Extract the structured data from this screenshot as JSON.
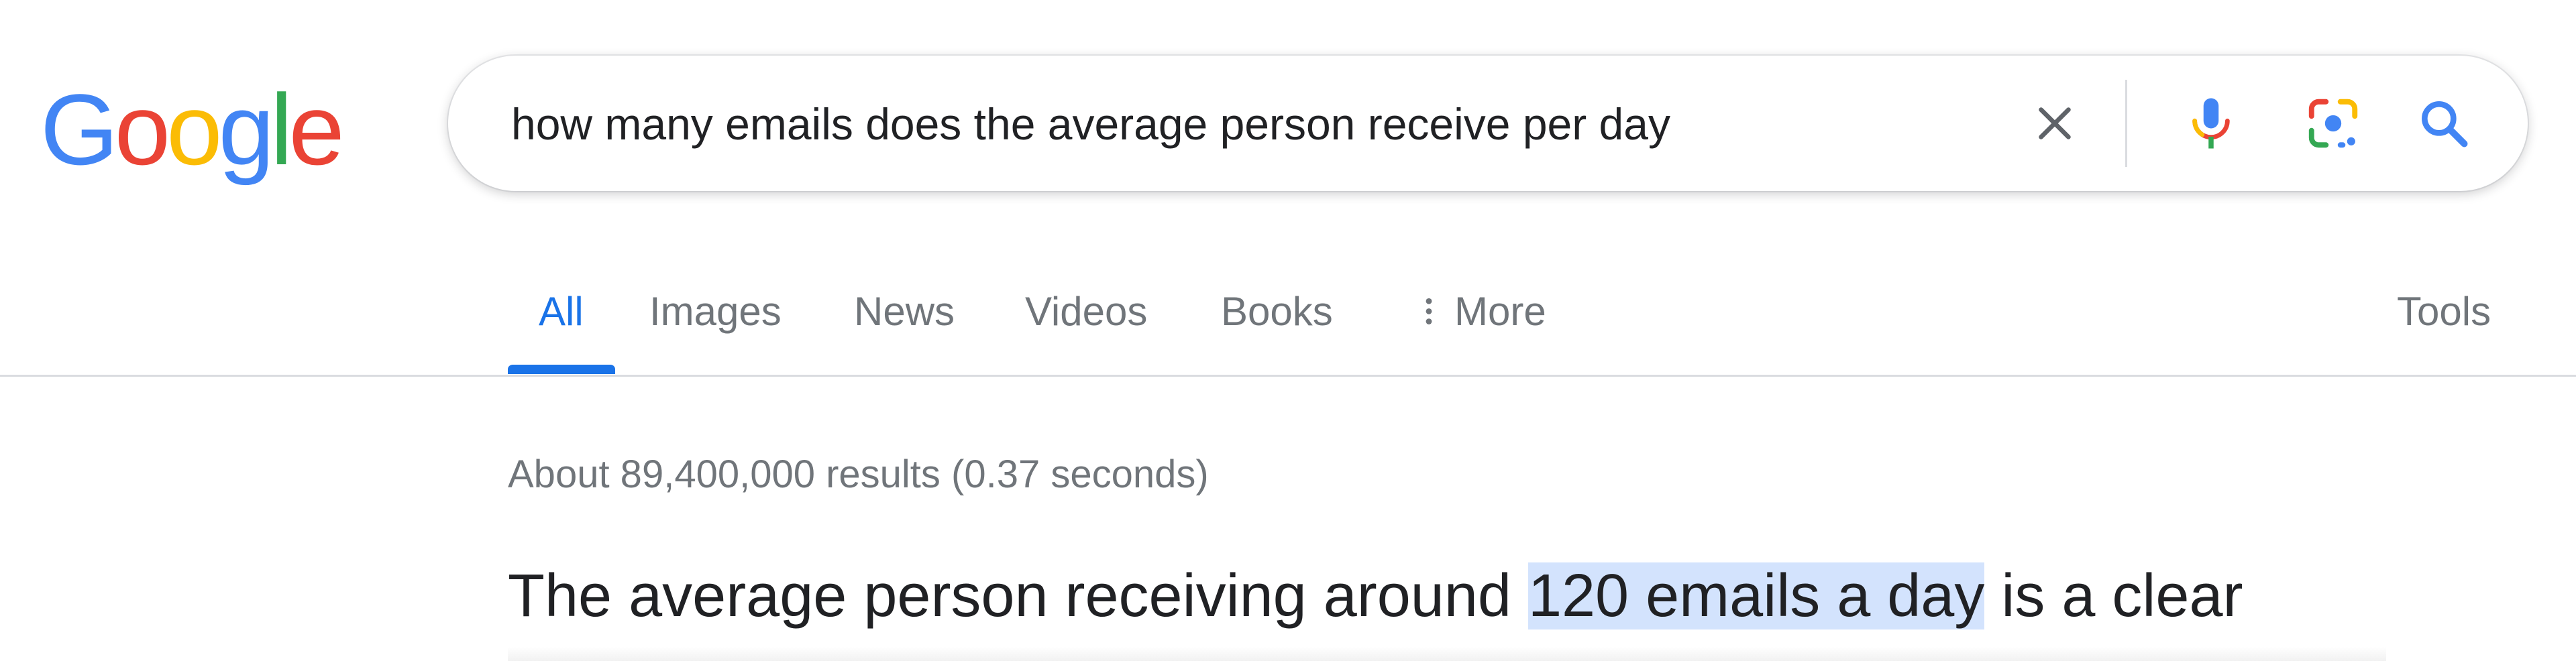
{
  "logo": {
    "letters": [
      "G",
      "o",
      "o",
      "g",
      "l",
      "e"
    ],
    "colors": [
      "#4285f4",
      "#ea4335",
      "#fbbc05",
      "#4285f4",
      "#34a853",
      "#ea4335"
    ]
  },
  "search": {
    "query": "how many emails does the average person receive per day"
  },
  "tabs": {
    "all": "All",
    "images": "Images",
    "news": "News",
    "videos": "Videos",
    "books": "Books",
    "more": "More",
    "tools": "Tools"
  },
  "results": {
    "stats": "About 89,400,000 results (0.37 seconds)",
    "snippet_before": "The average person receiving around ",
    "snippet_highlight": "120 emails a day",
    "snippet_after": " is a clear"
  },
  "colors": {
    "accent": "#1a73e8",
    "muted_text": "#70757a",
    "highlight": "#d3e3fd"
  },
  "icons": [
    "clear-icon",
    "microphone-icon",
    "lens-icon",
    "search-icon",
    "more-vert-icon"
  ]
}
